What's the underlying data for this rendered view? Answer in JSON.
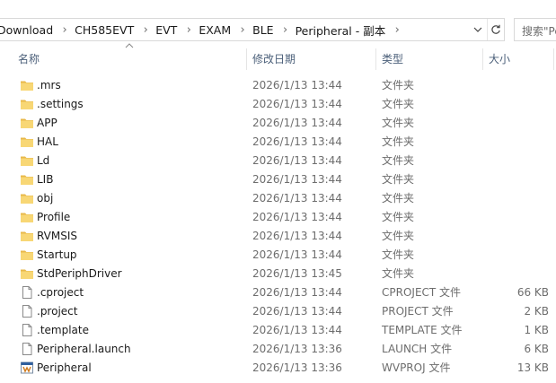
{
  "address": {
    "crumbs": [
      "Download",
      "CH585EVT",
      "EVT",
      "EXAM",
      "BLE",
      "Peripheral - 副本"
    ]
  },
  "search": {
    "placeholder": "搜索\"Pe"
  },
  "columns": {
    "name": "名称",
    "date": "修改日期",
    "type": "类型",
    "size": "大小"
  },
  "files": [
    {
      "name": ".mrs",
      "date": "2026/1/13 13:44",
      "type": "文件夹",
      "size": "",
      "icon": "folder-icon"
    },
    {
      "name": ".settings",
      "date": "2026/1/13 13:44",
      "type": "文件夹",
      "size": "",
      "icon": "folder-icon"
    },
    {
      "name": "APP",
      "date": "2026/1/13 13:44",
      "type": "文件夹",
      "size": "",
      "icon": "folder-icon"
    },
    {
      "name": "HAL",
      "date": "2026/1/13 13:44",
      "type": "文件夹",
      "size": "",
      "icon": "folder-icon"
    },
    {
      "name": "Ld",
      "date": "2026/1/13 13:44",
      "type": "文件夹",
      "size": "",
      "icon": "folder-icon"
    },
    {
      "name": "LIB",
      "date": "2026/1/13 13:44",
      "type": "文件夹",
      "size": "",
      "icon": "folder-icon"
    },
    {
      "name": "obj",
      "date": "2026/1/13 13:44",
      "type": "文件夹",
      "size": "",
      "icon": "folder-icon"
    },
    {
      "name": "Profile",
      "date": "2026/1/13 13:44",
      "type": "文件夹",
      "size": "",
      "icon": "folder-icon"
    },
    {
      "name": "RVMSIS",
      "date": "2026/1/13 13:44",
      "type": "文件夹",
      "size": "",
      "icon": "folder-icon"
    },
    {
      "name": "Startup",
      "date": "2026/1/13 13:44",
      "type": "文件夹",
      "size": "",
      "icon": "folder-icon"
    },
    {
      "name": "StdPeriphDriver",
      "date": "2026/1/13 13:45",
      "type": "文件夹",
      "size": "",
      "icon": "folder-icon"
    },
    {
      "name": ".cproject",
      "date": "2026/1/13 13:44",
      "type": "CPROJECT 文件",
      "size": "66 KB",
      "icon": "file-icon"
    },
    {
      "name": ".project",
      "date": "2026/1/13 13:44",
      "type": "PROJECT 文件",
      "size": "2 KB",
      "icon": "file-icon"
    },
    {
      "name": ".template",
      "date": "2026/1/13 13:44",
      "type": "TEMPLATE 文件",
      "size": "1 KB",
      "icon": "file-icon"
    },
    {
      "name": "Peripheral.launch",
      "date": "2026/1/13 13:36",
      "type": "LAUNCH 文件",
      "size": "6 KB",
      "icon": "file-icon"
    },
    {
      "name": "Peripheral",
      "date": "2026/1/13 13:36",
      "type": "WVPROJ 文件",
      "size": "13 KB",
      "icon": "wvproj-icon"
    }
  ],
  "colors": {
    "folder": "#f8d775",
    "folder_dark": "#e8b84a",
    "header_text": "#4c607a",
    "secondary_text": "#6d6d6d"
  }
}
